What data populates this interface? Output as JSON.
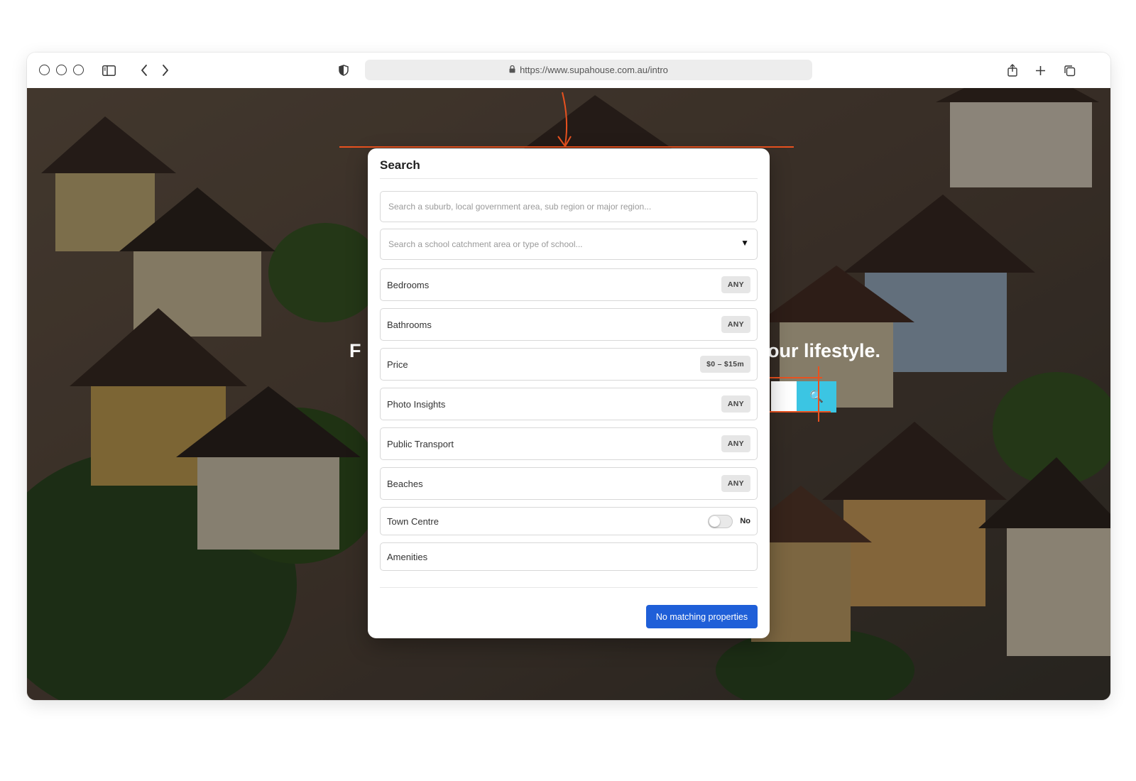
{
  "browser": {
    "url": "https://www.supahouse.com.au/intro"
  },
  "hero": {
    "heading_left": "F",
    "heading_right": "your lifestyle.",
    "search_icon": "🔍"
  },
  "modal": {
    "title": "Search",
    "location_placeholder": "Search a suburb, local government area, sub region or major region...",
    "school_placeholder": "Search a school catchment area or type of school...",
    "school_caret": "▼",
    "filters": [
      {
        "label": "Bedrooms",
        "value": "ANY"
      },
      {
        "label": "Bathrooms",
        "value": "ANY"
      },
      {
        "label": "Price",
        "value": "$0 – $15m"
      },
      {
        "label": "Photo Insights",
        "value": "ANY"
      },
      {
        "label": "Public Transport",
        "value": "ANY"
      },
      {
        "label": "Beaches",
        "value": "ANY"
      }
    ],
    "town_centre": {
      "label": "Town Centre",
      "state": "No"
    },
    "amenities": {
      "label": "Amenities"
    },
    "submit_label": "No matching properties"
  },
  "colors": {
    "accent": "#1f5fd8",
    "hero_search_button": "#3bc5e3",
    "annotation": "#e8511f"
  }
}
